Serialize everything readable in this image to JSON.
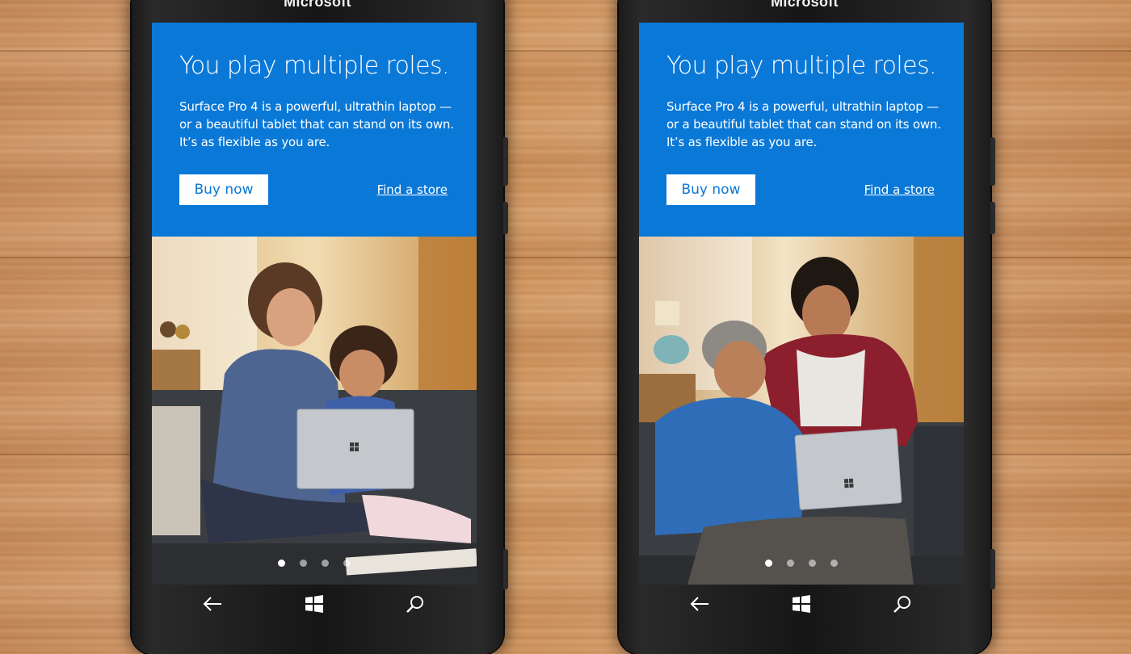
{
  "phones": [
    {
      "brand": "Microsoft",
      "hero": {
        "title": "You play multiple roles.",
        "body": "Surface Pro 4 is a powerful, ultrathin laptop — or a beautiful tablet that can stand on its own. It’s as flexible as you are.",
        "buy_label": "Buy now",
        "store_label": "Find a store"
      },
      "carousel": {
        "count": 4,
        "active_index": 0
      },
      "nav": {
        "back_icon": "back-arrow-icon",
        "home_icon": "windows-logo-icon",
        "search_icon": "search-icon"
      }
    },
    {
      "brand": "Microsoft",
      "hero": {
        "title": "You play multiple roles.",
        "body": "Surface Pro 4 is a powerful, ultrathin laptop — or a beautiful tablet that can stand on its own. It’s as flexible as you are.",
        "buy_label": "Buy now",
        "store_label": "Find a store"
      },
      "carousel": {
        "count": 4,
        "active_index": 0
      },
      "nav": {
        "back_icon": "back-arrow-icon",
        "home_icon": "windows-logo-icon",
        "search_icon": "search-icon"
      }
    }
  ],
  "colors": {
    "accent": "#0a78d7",
    "background_wood": "#d29c6c"
  }
}
